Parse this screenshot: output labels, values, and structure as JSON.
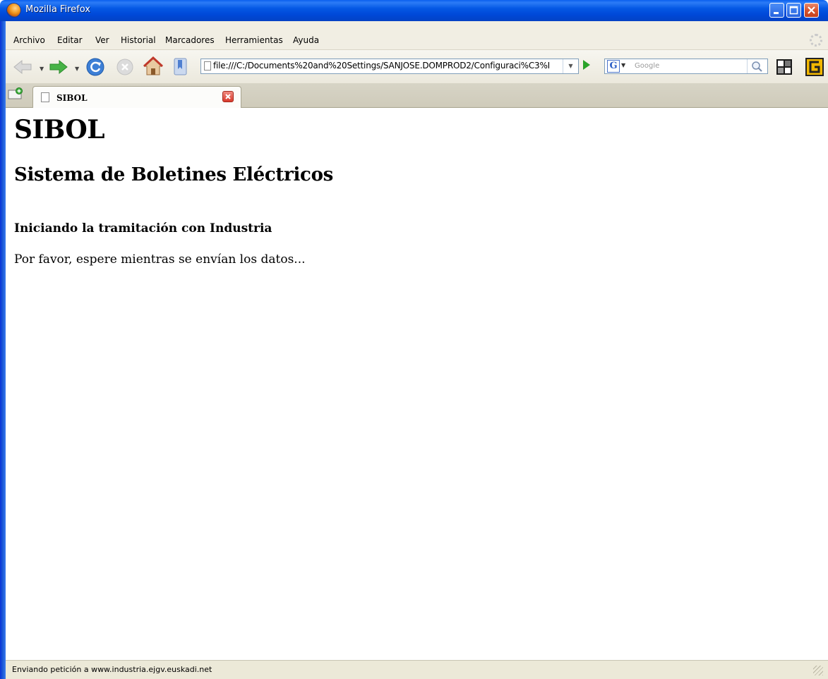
{
  "window": {
    "title": "Mozilla Firefox"
  },
  "menu": {
    "items": [
      "Archivo",
      "Editar",
      "Ver",
      "Historial",
      "Marcadores",
      "Herramientas",
      "Ayuda"
    ]
  },
  "toolbar": {
    "url": "file:///C:/Documents%20and%20Settings/SANJOSE.DOMPROD2/Configuraci%C3%I",
    "search_placeholder": "Google",
    "search_engine_icon": "G"
  },
  "tabs": [
    {
      "label": "SIBOL"
    }
  ],
  "page": {
    "heading": "SIBOL",
    "subheading": "Sistema de Boletines Eléctricos",
    "section_title": "Iniciando la tramitación con Industria",
    "message": "Por favor, espere mientras se envían los datos..."
  },
  "status": {
    "text": "Enviando petición a www.industria.ejgv.euskadi.net"
  },
  "colors": {
    "titlebar": "#0458e4",
    "chrome": "#ece9d8",
    "go_button": "#29a329"
  }
}
